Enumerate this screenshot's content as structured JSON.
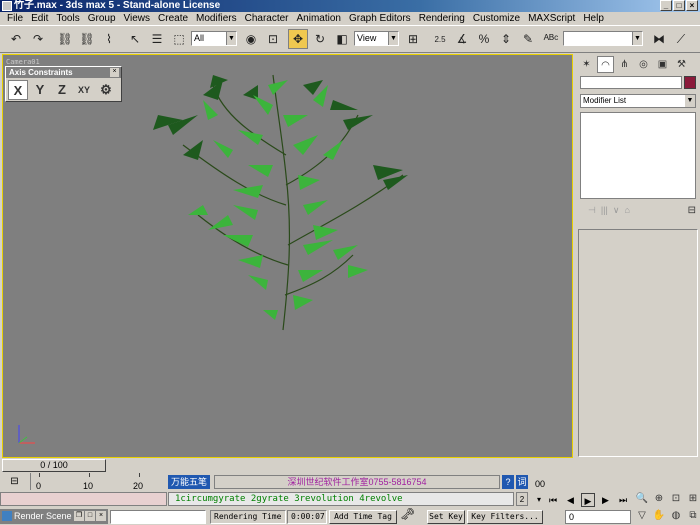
{
  "window": {
    "title": "竹子.max - 3ds max 5 - Stand-alone License",
    "controls": [
      "_",
      "□",
      "×"
    ]
  },
  "menu": [
    "File",
    "Edit",
    "Tools",
    "Group",
    "Views",
    "Create",
    "Modifiers",
    "Character",
    "Animation",
    "Graph Editors",
    "Rendering",
    "Customize",
    "MAXScript",
    "Help"
  ],
  "toolbar": {
    "selection_filter": "All",
    "ref_coord": "View",
    "named_selection": "",
    "angle_snap_label": "2.5"
  },
  "viewport": {
    "label": "Camera01",
    "axis_constraints": {
      "title": "Axis Constraints",
      "close": "×",
      "buttons": [
        "X",
        "Y",
        "Z",
        "XY"
      ]
    }
  },
  "command_panel": {
    "modifier_list": "Modifier List"
  },
  "timeline": {
    "position": "0 / 100",
    "ticks": [
      "0",
      "10",
      "20"
    ],
    "end_label": "00"
  },
  "ime": {
    "label": "万能五笔",
    "studio": "深圳世纪软件工作室0755-5816754",
    "help": "?",
    "word": "词"
  },
  "maxscript": {
    "output": "1circumgyrate 2gyrate 3revolution 4revolve",
    "page": "2"
  },
  "taskbar": {
    "render_scene": "Render Scene"
  },
  "status": {
    "rendering_time_label": "Rendering Time",
    "rendering_time_value": "0:00:07",
    "add_time_tag": "Add Time Tag",
    "set_key": "Set Key",
    "key_filters": "Key Filters...",
    "current_frame": "0"
  },
  "colors": {
    "viewport_bg": "#7f7f7f",
    "active_border": "#e8d000",
    "object_color": "#8b1a3a",
    "leaf_dark": "#1e5a1e",
    "leaf_light": "#3cb43c"
  }
}
